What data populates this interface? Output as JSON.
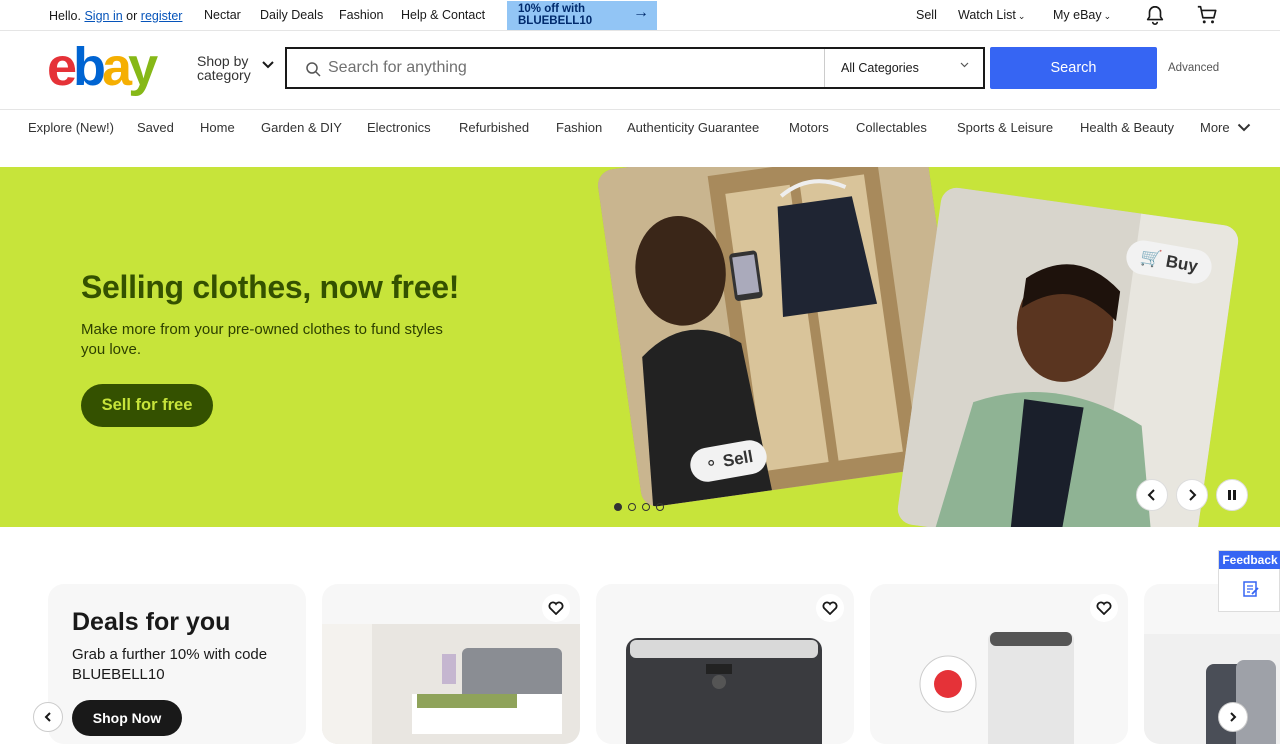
{
  "topbar": {
    "hello": "Hello.",
    "sign_in": "Sign in",
    "or": "or",
    "register": "register",
    "nav": [
      "Nectar",
      "Daily Deals",
      "Fashion",
      "Help & Contact"
    ],
    "promo_line1": "10% off with",
    "promo_line2": "BLUEBELL10",
    "sell": "Sell",
    "watch_list": "Watch List",
    "my_ebay": "My eBay"
  },
  "header": {
    "logo_letters": [
      "e",
      "b",
      "a",
      "y"
    ],
    "shop_by_line1": "Shop by",
    "shop_by_line2": "category",
    "search_placeholder": "Search for anything",
    "category_value": "All Categories",
    "search_button": "Search",
    "advanced": "Advanced"
  },
  "catnav": {
    "items": [
      "Explore (New!)",
      "Saved",
      "Home",
      "Garden & DIY",
      "Electronics",
      "Refurbished",
      "Fashion",
      "Authenticity Guarantee",
      "Motors",
      "Collectables",
      "Sports & Leisure",
      "Health & Beauty",
      "More"
    ]
  },
  "hero": {
    "title": "Selling clothes, now free!",
    "subtitle": "Make more from your pre-owned clothes to fund styles you love.",
    "cta": "Sell for free",
    "tag_sell": "Sell",
    "tag_buy": "Buy",
    "slide_count": 4,
    "active_slide": 1
  },
  "deals": {
    "title": "Deals for you",
    "subtitle": "Grab a further 10% with code BLUEBELL10",
    "button": "Shop Now"
  },
  "feedback": {
    "label": "Feedback"
  },
  "colors": {
    "hero_bg": "#c7e43a",
    "hero_text": "#345100",
    "search_blue": "#3665f3",
    "link_blue": "#0654ba"
  }
}
